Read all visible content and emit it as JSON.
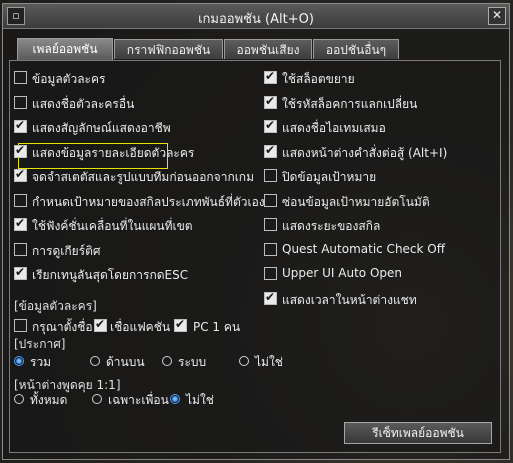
{
  "window": {
    "title": "เกมออพชัน (Alt+O)"
  },
  "tabs": [
    {
      "label": "เพลย์ออพชัน",
      "active": true
    },
    {
      "label": "กราฟฟิกออพชัน",
      "active": false
    },
    {
      "label": "ออพชันเสียง",
      "active": false
    },
    {
      "label": "ออปชันอื่นๆ",
      "active": false
    }
  ],
  "left_options": [
    {
      "label": "ข้อมูลตัวละคร",
      "checked": false
    },
    {
      "label": "แสดงชื่อตัวละครอื่น",
      "checked": false
    },
    {
      "label": "แสดงสัญลักษณ์แสดงอาชีพ",
      "checked": true
    },
    {
      "label": "แสดงข้อมูลรายละเอียดตัวละคร",
      "checked": true
    },
    {
      "label": "จดจำสเตตัสและรูปแบบทีมก่อนออกจากเกม",
      "checked": true
    },
    {
      "label": "กำหนดเป้าหมายของสกิลประเภทพันธ์ที่ตัวเอง",
      "checked": false
    },
    {
      "label": "ใช้ฟังค์ชั่นเคลื่อนที่ในแผนที่เขต",
      "checked": true
    },
    {
      "label": "การดูเกียร์ติศ",
      "checked": false
    },
    {
      "label": "เรียกเทนูลันสุดโดยการกดESC",
      "checked": true
    }
  ],
  "right_options": [
    {
      "label": "ใช้สล็อตขยาย",
      "checked": true
    },
    {
      "label": "ใช้รหัสล็อคการแลกเปลี่ยน",
      "checked": true
    },
    {
      "label": "แสดงชื่อไอเทมเสมอ",
      "checked": true
    },
    {
      "label": "แสดงหน้าต่างคำสั่งต่อสู้ (Alt+I)",
      "checked": true
    },
    {
      "label": "ปิดข้อมูลเป้าหมาย",
      "checked": false
    },
    {
      "label": "ซ่อนข้อมูลเป้าหมายอัตโนมัติ",
      "checked": false
    },
    {
      "label": "แสดงระยะของสกิล",
      "checked": false
    },
    {
      "label": "Quest Automatic Check Off",
      "checked": false
    },
    {
      "label": "Upper UI Auto Open",
      "checked": false
    },
    {
      "label": "แสดงเวลาในหน้าต่างแชท",
      "checked": true
    }
  ],
  "character_section": {
    "title": "[ข้อมูลตัวละคร]",
    "items": [
      {
        "label": "กรุณาตั้งชื่อ",
        "checked": false
      },
      {
        "label": "เชื่อแฟคชัน",
        "checked": true
      },
      {
        "label": "PC 1 คน",
        "checked": true
      }
    ]
  },
  "announce_section": {
    "title": "[ประกาศ]",
    "options": [
      "รวม",
      "ด้านบน",
      "ระบบ",
      "ไม่ใช่"
    ],
    "selected": "รวม"
  },
  "chat_section": {
    "title": "[หน้าต่างพูดคุย 1:1]",
    "options": [
      "ทั้งหมด",
      "เฉพาะเพื่อน",
      "ไม่ใช่"
    ],
    "selected": "ไม่ใช่"
  },
  "buttons": {
    "reset": "รีเซ็ทเพลย์ออพชัน"
  },
  "icons": {
    "window": "window-icon",
    "close": "close-icon"
  }
}
